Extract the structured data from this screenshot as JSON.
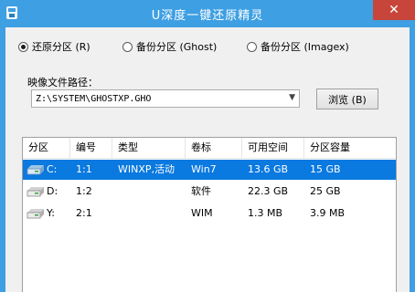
{
  "window": {
    "title": "U深度一键还原精灵",
    "close_glyph": "✕"
  },
  "modes": [
    {
      "label": "还原分区 (R)",
      "selected": true
    },
    {
      "label": "备份分区 (Ghost)",
      "selected": false
    },
    {
      "label": "备份分区 (Imagex)",
      "selected": false
    }
  ],
  "image_path": {
    "label": "映像文件路径：",
    "value": "Z:\\SYSTEM\\GHOSTXP.GHO"
  },
  "browse_label": "浏览 (B)",
  "table": {
    "headers": [
      "分区",
      "编号",
      "类型",
      "卷标",
      "可用空间",
      "分区容量"
    ],
    "rows": [
      {
        "drive": "C:",
        "number": "1:1",
        "type": "WINXP,活动",
        "volume": "Win7",
        "free": "13.6 GB",
        "capacity": "15 GB",
        "selected": true
      },
      {
        "drive": "D:",
        "number": "1:2",
        "type": "",
        "volume": "软件",
        "free": "22.3 GB",
        "capacity": "25 GB",
        "selected": false
      },
      {
        "drive": "Y:",
        "number": "2:1",
        "type": "",
        "volume": "WIM",
        "free": "1.3 MB",
        "capacity": "3.9 MB",
        "selected": false
      }
    ]
  },
  "colors": {
    "titlebar": "#3e9fe3",
    "close": "#c7453a",
    "selection": "#0a79e0"
  },
  "icons": {
    "app": "app-icon",
    "disk": "hard-disk-icon",
    "dropdown": "chevron-down-icon"
  }
}
